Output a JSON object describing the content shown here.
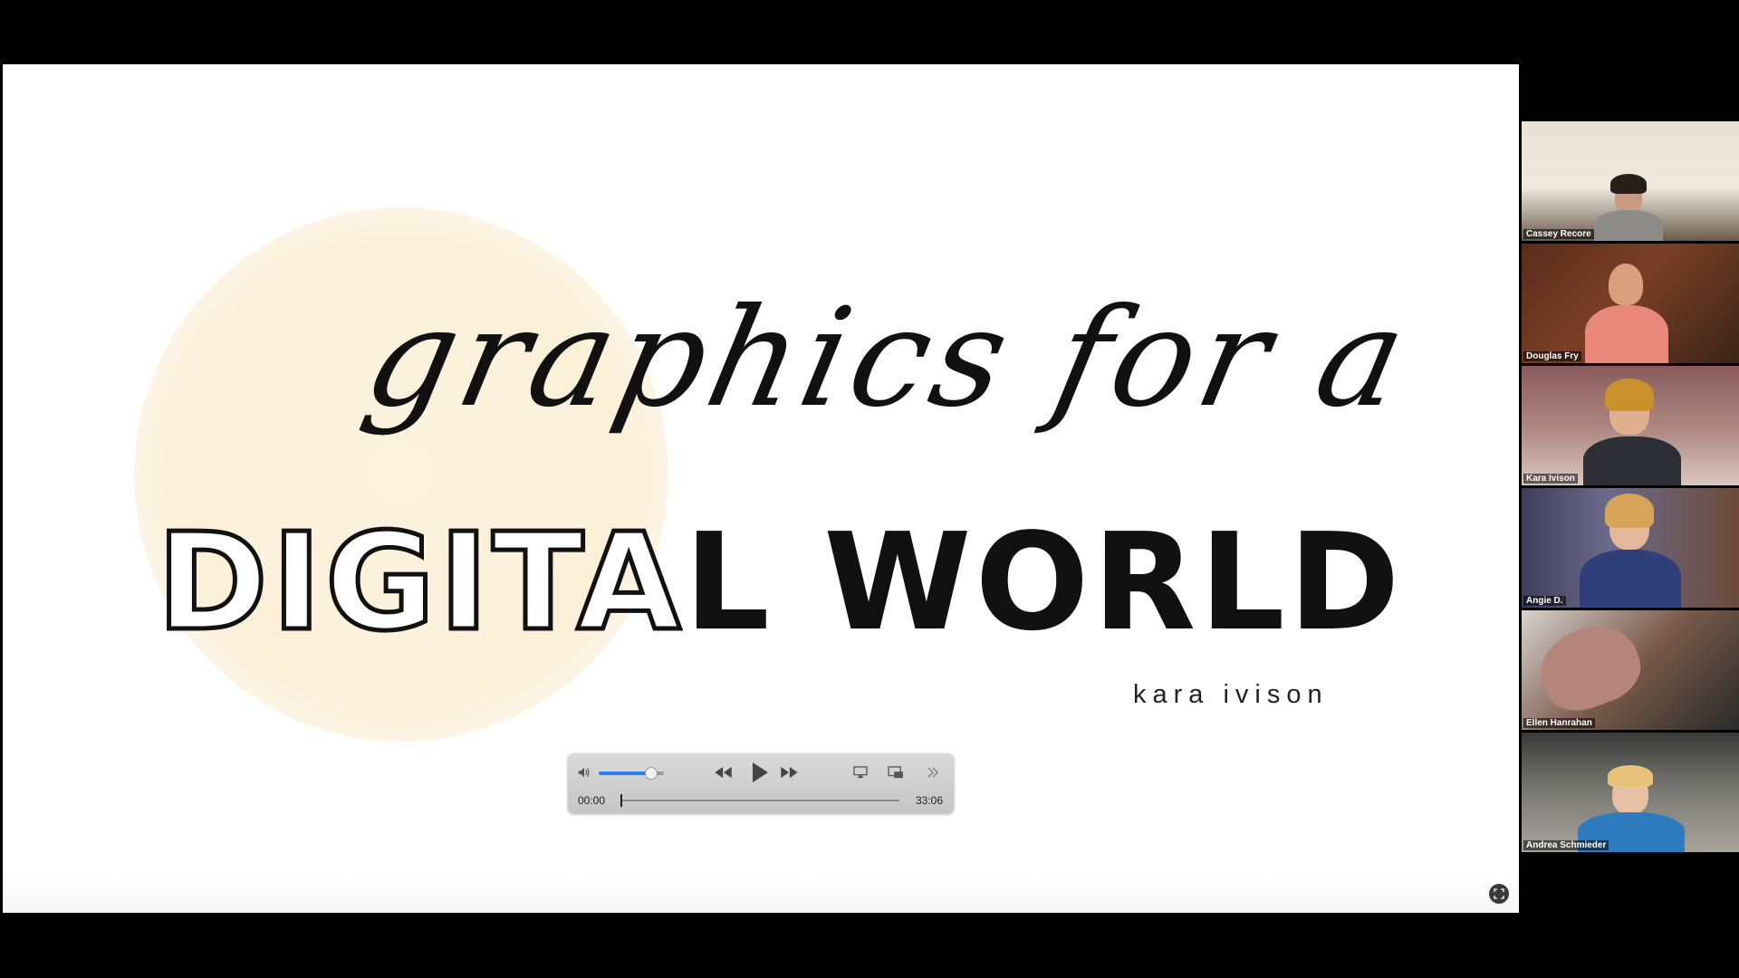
{
  "slide": {
    "script_title": "graphics for a",
    "big_title_outline": "DIGITA",
    "big_title_solid": "L WORLD",
    "byline": "kara ivison"
  },
  "player": {
    "current_time": "00:00",
    "duration": "33:06",
    "volume_level": 0.8,
    "progress": 0.0
  },
  "participants": [
    {
      "name": "Cassey Recore"
    },
    {
      "name": "Douglas Fry"
    },
    {
      "name": "Kara Ivison"
    },
    {
      "name": "Angie D."
    },
    {
      "name": "Ellen Hanrahan"
    },
    {
      "name": "Andrea Schmieder"
    }
  ],
  "colors": {
    "accent_blue": "#2d7ff0",
    "sun": "#fcf0d8"
  }
}
